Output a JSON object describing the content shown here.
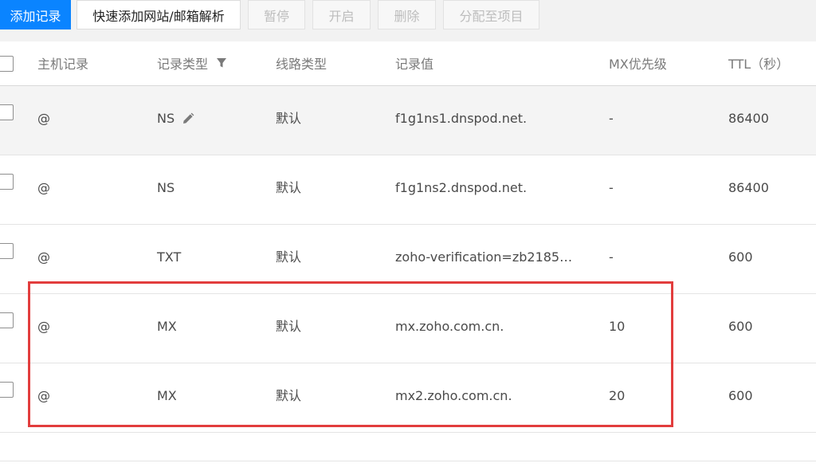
{
  "toolbar": {
    "add_record": "添加记录",
    "quick_add": "快速添加网站/邮箱解析",
    "pause": "暂停",
    "enable": "开启",
    "delete": "删除",
    "assign_project": "分配至项目"
  },
  "table": {
    "columns": [
      "主机记录",
      "记录类型",
      "线路类型",
      "记录值",
      "MX优先级",
      "TTL（秒）"
    ],
    "rows": [
      [
        "@",
        "NS",
        "默认",
        "f1g1ns1.dnspod.net.",
        "-",
        "86400"
      ],
      [
        "@",
        "NS",
        "默认",
        "f1g1ns2.dnspod.net.",
        "-",
        "86400"
      ],
      [
        "@",
        "TXT",
        "默认",
        "zoho-verification=zb2185…",
        "-",
        "600"
      ],
      [
        "@",
        "MX",
        "默认",
        "mx.zoho.com.cn.",
        "10",
        "600"
      ],
      [
        "@",
        "MX",
        "默认",
        "mx2.zoho.com.cn.",
        "20",
        "600"
      ]
    ]
  },
  "icons": {
    "filter": "filter-icon",
    "edit": "pencil-icon"
  },
  "colors": {
    "primary": "#0a84ff",
    "highlight": "#e23d3d"
  }
}
